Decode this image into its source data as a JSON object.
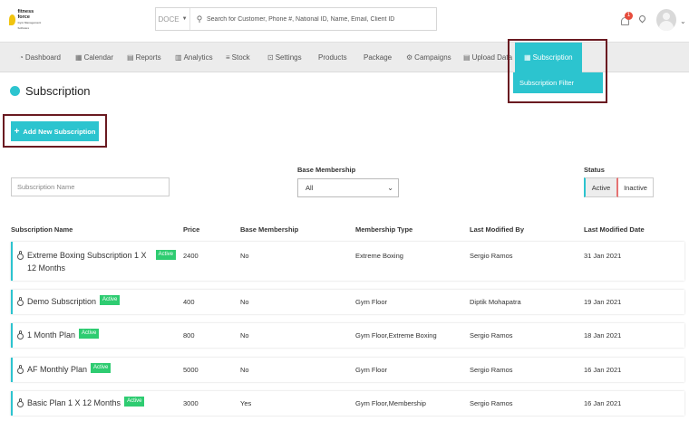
{
  "header": {
    "logo_text": "fitness force",
    "logo_sub": "Gym Management Software",
    "search_scope": "DOCE",
    "search_placeholder": "Search for Customer, Phone #, National ID, Name, Email, Client ID",
    "notification_count": "1"
  },
  "nav": {
    "items": [
      {
        "label": "Dashboard",
        "icon": "dashboard-icon",
        "glyph": "⚙"
      },
      {
        "label": "Calendar",
        "icon": "calendar-icon",
        "glyph": "▦"
      },
      {
        "label": "Reports",
        "icon": "report-icon",
        "glyph": "▤"
      },
      {
        "label": "Analytics",
        "icon": "bar-chart-icon",
        "glyph": "▥"
      },
      {
        "label": "Stock",
        "icon": "list-icon",
        "glyph": "≡"
      },
      {
        "label": "Settings",
        "icon": "settings-icon",
        "glyph": "⊡"
      },
      {
        "label": "Products",
        "icon": "",
        "glyph": ""
      },
      {
        "label": "Package",
        "icon": "",
        "glyph": ""
      },
      {
        "label": "Campaigns",
        "icon": "gear-icon",
        "glyph": "⚙"
      },
      {
        "label": "Upload Data",
        "icon": "database-icon",
        "glyph": "▤"
      },
      {
        "label": "Subscription",
        "icon": "calendar-icon",
        "glyph": "▦"
      }
    ],
    "dropdown_item": "Subscription Filter"
  },
  "page": {
    "title": "Subscription",
    "add_button": "Add New Subscription"
  },
  "filters": {
    "name_placeholder": "Subscription Name",
    "base_label": "Base Membership",
    "base_value": "All",
    "status_label": "Status",
    "status_active": "Active",
    "status_inactive": "Inactive"
  },
  "table": {
    "headers": [
      "Subscription Name",
      "Price",
      "Base Membership",
      "Membership Type",
      "Last Modified By",
      "Last Modified Date"
    ],
    "badge": "Active",
    "rows": [
      {
        "name": "Extreme Boxing Subscription 1 X 12 Months",
        "price": "2400",
        "base": "No",
        "type": "Extreme Boxing",
        "modified_by": "Sergio Ramos",
        "date": "31 Jan 2021"
      },
      {
        "name": "Demo Subscription",
        "price": "400",
        "base": "No",
        "type": "Gym Floor",
        "modified_by": "Diptik Mohapatra",
        "date": "19 Jan 2021"
      },
      {
        "name": "1 Month Plan",
        "price": "800",
        "base": "No",
        "type": "Gym Floor,Extreme Boxing",
        "modified_by": "Sergio Ramos",
        "date": "18 Jan 2021"
      },
      {
        "name": "AF Monthly Plan",
        "price": "5000",
        "base": "No",
        "type": "Gym Floor",
        "modified_by": "Sergio Ramos",
        "date": "16 Jan 2021"
      },
      {
        "name": "Basic Plan 1 X 12 Months",
        "price": "3000",
        "base": "Yes",
        "type": "Gym Floor,Membership",
        "modified_by": "Sergio Ramos",
        "date": "16 Jan 2021"
      }
    ]
  },
  "colors": {
    "accent": "#2cc4cf",
    "badge": "#2ecc71",
    "highlight": "#6a1a21"
  }
}
